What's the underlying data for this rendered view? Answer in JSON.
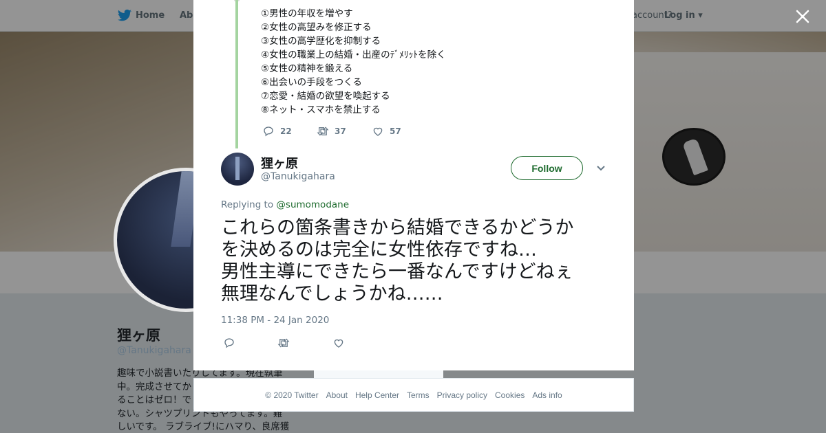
{
  "nav": {
    "home": "Home",
    "about": "Abo",
    "account_prompt": "account?",
    "login": "Log in"
  },
  "profile": {
    "name": "狸ヶ原",
    "handle": "@Tanukigahara",
    "bio_lines": [
      "趣味で小説書いたりしてます。現在執筆",
      "中。完成させてか",
      "ることはゼロ！で",
      "ない。シャツプリントもやってます。難",
      "しいです。 ラブライブ!にハマり、良席獲"
    ]
  },
  "parent_tweet": {
    "list": [
      "①男性の年収を増やす",
      "②女性の高望みを修正する",
      "③女性の高学歴化を抑制する",
      "④女性の職業上の結婚・出産のﾃﾞﾒﾘｯﾄを除く",
      "⑤女性の精神を鍛える",
      "⑥出会いの手段をつくる",
      "⑦恋愛・結婚の欲望を喚起する",
      "⑧ネット・スマホを禁止する"
    ],
    "replies": "22",
    "retweets": "37",
    "likes": "57"
  },
  "tweet": {
    "author_name": "狸ヶ原",
    "author_handle": "@Tanukigahara",
    "follow_label": "Follow",
    "replying_label": "Replying to",
    "replying_to": "@sumomodane",
    "text_lines": [
      "これらの箇条書きから結婚できるかどうか",
      "を決めるのは完全に女性依存ですね…",
      "男性主導にできたら一番なんですけどねぇ",
      "無理なんでしょうかね……"
    ],
    "timestamp": "11:38 PM - 24 Jan 2020"
  },
  "footer": {
    "links": [
      "© 2020 Twitter",
      "About",
      "Help Center",
      "Terms",
      "Privacy policy",
      "Cookies",
      "Ads info"
    ]
  },
  "colors": {
    "accent": "#1e6b2e",
    "thread_line": "#a4d4a0",
    "muted_text": "#657786"
  },
  "icons": [
    "twitter-bird-icon",
    "reply-icon",
    "retweet-icon",
    "like-icon",
    "chevron-down-icon",
    "close-icon"
  ]
}
